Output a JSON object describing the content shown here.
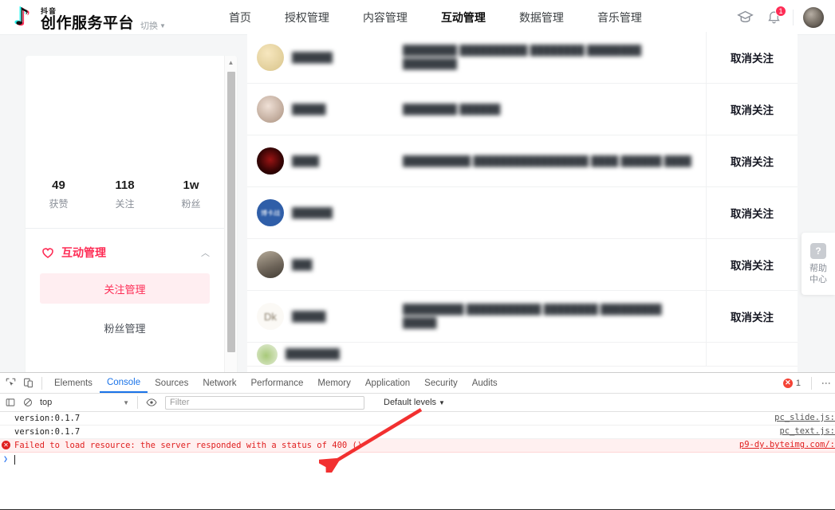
{
  "header": {
    "brand_sub": "抖音",
    "brand_main": "创作服务平台",
    "switch_label": "切换",
    "switch_caret": "▼",
    "nav": [
      {
        "label": "首页",
        "active": false
      },
      {
        "label": "授权管理",
        "active": false
      },
      {
        "label": "内容管理",
        "active": false
      },
      {
        "label": "互动管理",
        "active": true
      },
      {
        "label": "数据管理",
        "active": false
      },
      {
        "label": "音乐管理",
        "active": false
      }
    ],
    "icons": {
      "school": "graduation-cap-icon",
      "bell": "bell-icon",
      "avatar": "avatar"
    },
    "notification_count": "1"
  },
  "sidebar": {
    "stats": [
      {
        "value": "49",
        "label": "获赞"
      },
      {
        "value": "118",
        "label": "关注"
      },
      {
        "value": "1w",
        "label": "粉丝"
      }
    ],
    "group": {
      "title": "互动管理",
      "icon": "heart-refresh-icon",
      "chevron": "︿"
    },
    "items": [
      {
        "label": "关注管理",
        "active": true
      },
      {
        "label": "粉丝管理",
        "active": false
      }
    ],
    "scrollbar": {
      "up": "▲",
      "down": "▼"
    }
  },
  "list": {
    "action_label": "取消关注",
    "rows": [
      {
        "name": "██████",
        "desc": "████████ ██████████ ████████\n████████ ████████",
        "avatar_color": "#f3e6c8",
        "avatar_color2": "#d8c48a",
        "avatar_text": "",
        "partial": false
      },
      {
        "name": "█████",
        "desc": "████████ ██████",
        "avatar_color": "#e8d9cf",
        "avatar_color2": "#b09a8a",
        "avatar_text": "",
        "partial": false
      },
      {
        "name": "████",
        "desc": "██████████ █████████████████\n████ ██████ ████",
        "avatar_color": "#5a0a0a",
        "avatar_color2": "#140000",
        "avatar_text": "",
        "partial": false
      },
      {
        "name": "██████",
        "desc": "",
        "avatar_color": "#2f5ea8",
        "avatar_color2": "#1d3f78",
        "avatar_text": "博卡战",
        "partial": false
      },
      {
        "name": "███",
        "desc": "",
        "avatar_color": "#9a8f80",
        "avatar_color2": "#5e564c",
        "avatar_text": "",
        "partial": false
      },
      {
        "name": "█████",
        "desc": "█████████ ███████████ ████████\n█████████ █████",
        "avatar_color": "#f7f3ee",
        "avatar_color2": "#cfc6b8",
        "avatar_text": "Dk",
        "partial": false
      },
      {
        "name": "████████",
        "desc": "",
        "avatar_color": "#e7efdc",
        "avatar_color2": "#9fbd72",
        "avatar_text": "",
        "partial": true
      }
    ]
  },
  "help": {
    "icon": "question-mark-icon",
    "line1": "帮助",
    "line2": "中心"
  },
  "devtools": {
    "toolbar_icons": {
      "inspect": "inspect-element-icon",
      "device": "device-toolbar-icon"
    },
    "tabs": [
      {
        "label": "Elements",
        "active": false
      },
      {
        "label": "Console",
        "active": true
      },
      {
        "label": "Sources",
        "active": false
      },
      {
        "label": "Network",
        "active": false
      },
      {
        "label": "Performance",
        "active": false
      },
      {
        "label": "Memory",
        "active": false
      },
      {
        "label": "Application",
        "active": false
      },
      {
        "label": "Security",
        "active": false
      },
      {
        "label": "Audits",
        "active": false
      }
    ],
    "error_count": "1",
    "error_glyph": "✕",
    "kebab": "⋮",
    "filters": {
      "context_value": "top",
      "context_caret": "▼",
      "eye_icon": "eye-icon",
      "filter_placeholder": "Filter",
      "levels_label": "Default levels",
      "levels_caret": "▼"
    },
    "messages": [
      {
        "text": "version:0.1.7",
        "source": "pc_slide.js:",
        "level": "log"
      },
      {
        "text": "version:0.1.7",
        "source": "pc_text.js:",
        "level": "log"
      },
      {
        "text": "Failed to load resource: the server responded with a status of 400 ()",
        "source": "p9-dy.byteimg.com/:",
        "level": "error"
      }
    ],
    "prompt_arrow": "❯"
  },
  "annotation": {
    "type": "red-arrow",
    "color": "#f23030"
  }
}
